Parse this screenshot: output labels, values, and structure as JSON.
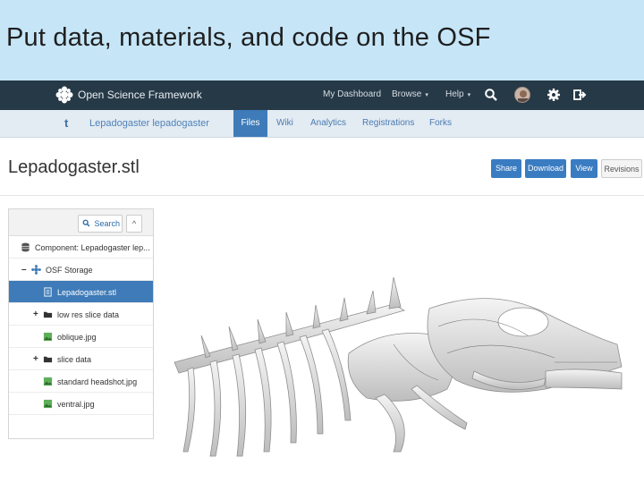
{
  "slide": {
    "title": "Put data, materials, and code on the OSF"
  },
  "navbar": {
    "brand": "Open Science Framework",
    "links": [
      "My Dashboard",
      "Browse",
      "Help"
    ],
    "icons": [
      "search-icon",
      "avatar",
      "gear-icon",
      "logout-icon"
    ]
  },
  "subnav": {
    "up_icon": "t",
    "project": "Lepadogaster lepadogaster",
    "tabs": [
      "Files",
      "Wiki",
      "Analytics",
      "Registrations",
      "Forks"
    ],
    "active_tab": "Files"
  },
  "file": {
    "title": "Lepadogaster.stl",
    "buttons": [
      "Share",
      "Download",
      "View",
      "Revisions"
    ]
  },
  "tree": {
    "search_label": "Search",
    "collapse_label": "^",
    "rows": [
      {
        "label": "Component: Lepadogaster lep...",
        "toggle": "",
        "icon": "database-icon",
        "selected": false
      },
      {
        "label": "OSF Storage",
        "toggle": "–",
        "icon": "storage-icon",
        "selected": false
      },
      {
        "label": "Lepadogaster.stl",
        "toggle": "",
        "icon": "file-icon",
        "selected": true
      },
      {
        "label": "low res slice data",
        "toggle": "+",
        "icon": "folder-icon",
        "selected": false
      },
      {
        "label": "oblique.jpg",
        "toggle": "",
        "icon": "image-icon",
        "selected": false
      },
      {
        "label": "slice data",
        "toggle": "+",
        "icon": "folder-icon",
        "selected": false
      },
      {
        "label": "standard headshot.jpg",
        "toggle": "",
        "icon": "image-icon",
        "selected": false
      },
      {
        "label": "ventral.jpg",
        "toggle": "",
        "icon": "image-icon",
        "selected": false
      }
    ]
  },
  "colors": {
    "navbar": "#263947",
    "accent": "#3e7bb8",
    "slide_header": "#c6e6f8"
  }
}
